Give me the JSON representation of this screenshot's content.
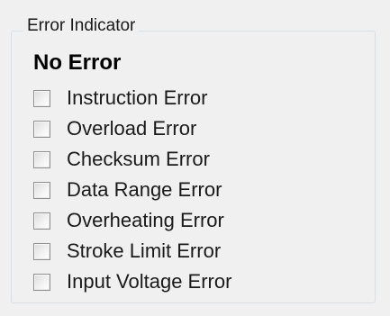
{
  "group": {
    "title": "Error Indicator"
  },
  "status": {
    "text": "No Error"
  },
  "errors": [
    {
      "label": "Instruction Error",
      "checked": false
    },
    {
      "label": "Overload Error",
      "checked": false
    },
    {
      "label": "Checksum Error",
      "checked": false
    },
    {
      "label": "Data Range Error",
      "checked": false
    },
    {
      "label": "Overheating Error",
      "checked": false
    },
    {
      "label": "Stroke Limit Error",
      "checked": false
    },
    {
      "label": "Input Voltage Error",
      "checked": false
    }
  ]
}
